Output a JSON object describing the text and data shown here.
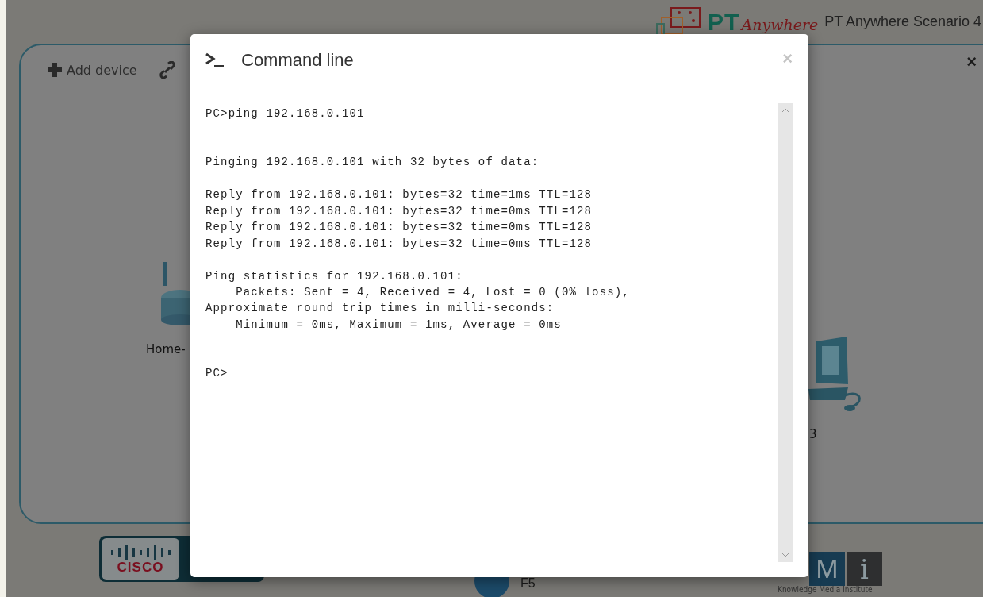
{
  "header": {
    "logo_pt": "PT",
    "logo_anywhere": "Anywhere",
    "title": "PT Anywhere Scenario 4"
  },
  "canvas": {
    "add_device": "Add device",
    "close": "×",
    "devices": [
      {
        "kind": "router",
        "label": "Home-"
      },
      {
        "kind": "pc",
        "label": "3"
      }
    ]
  },
  "footer": {
    "cisco": "CISCO",
    "f5": "F5",
    "kmi_letters": [
      "M",
      "i"
    ],
    "kmi_caption": "Knowledge Media Institute"
  },
  "dialog": {
    "title": "Command line",
    "close": "×",
    "output": "PC>ping 192.168.0.101\n\n\nPinging 192.168.0.101 with 32 bytes of data:\n\nReply from 192.168.0.101: bytes=32 time=1ms TTL=128\nReply from 192.168.0.101: bytes=32 time=0ms TTL=128\nReply from 192.168.0.101: bytes=32 time=0ms TTL=128\nReply from 192.168.0.101: bytes=32 time=0ms TTL=128\n\nPing statistics for 192.168.0.101:\n    Packets: Sent = 4, Received = 4, Lost = 0 (0% loss),\nApproximate round trip times in milli-seconds:\n    Minimum = 0ms, Maximum = 1ms, Average = 0ms\n\n\nPC>"
  }
}
